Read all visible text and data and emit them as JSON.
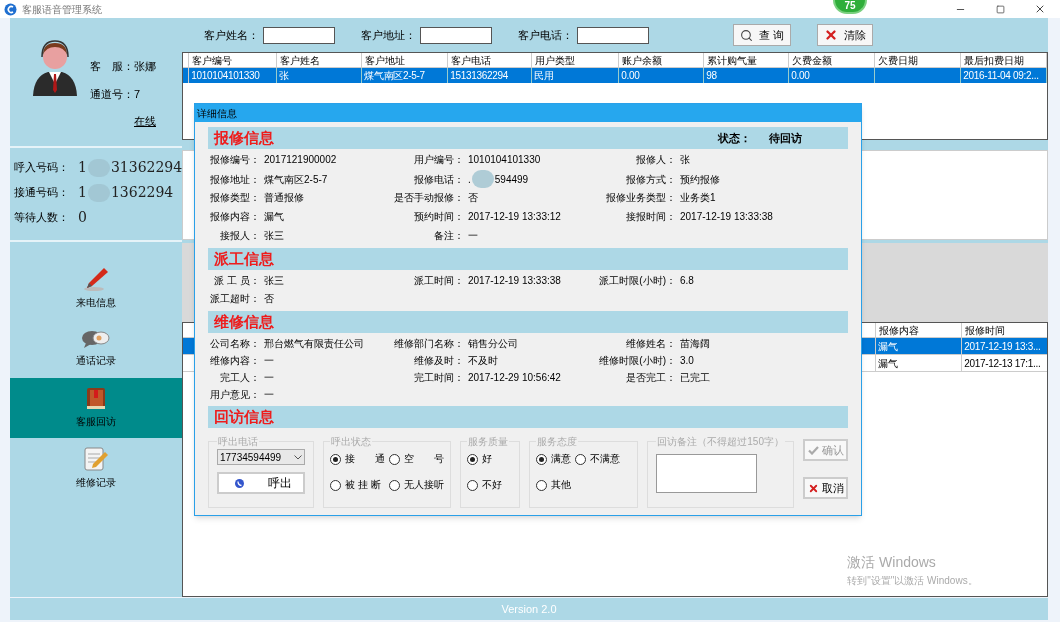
{
  "window": {
    "title": "客服语音管理系统",
    "badge": "75"
  },
  "agent": {
    "rows": [
      {
        "label": "客　服：",
        "value": "张娜"
      },
      {
        "label": "通道号：",
        "value": "7"
      }
    ],
    "status": "在线"
  },
  "call_info": [
    {
      "label": "呼入号码：",
      "value": "1",
      "value_end": "31362294"
    },
    {
      "label": "接通号码：",
      "value": "1",
      "value_end": "1362294"
    },
    {
      "label": "等待人数：",
      "value": "0"
    }
  ],
  "nav": [
    {
      "label": "来电信息",
      "kind": "pen",
      "selected": false
    },
    {
      "label": "通话记录",
      "kind": "chat",
      "selected": false
    },
    {
      "label": "客服回访",
      "kind": "book",
      "selected": true
    },
    {
      "label": "维修记录",
      "kind": "notepad",
      "selected": false
    }
  ],
  "search": {
    "fields": [
      {
        "label": "客户姓名："
      },
      {
        "label": "客户地址："
      },
      {
        "label": "客户电话："
      }
    ],
    "buttons": [
      {
        "label": "查 询",
        "kind": "search"
      },
      {
        "label": "清除",
        "kind": "clear"
      }
    ]
  },
  "customers": {
    "columns": [
      "客户编号",
      "客户姓名",
      "客户地址",
      "客户电话",
      "用户类型",
      "账户余额",
      "累计购气量",
      "欠费金额",
      "欠费日期",
      "最后扣费日期"
    ],
    "rows": [
      {
        "cells": [
          "1010104101330",
          "张",
          "煤气南区2-5-7",
          "15131362294",
          "民用",
          "0.00",
          "98",
          "0.00",
          "",
          "2016-11-04 09:2..."
        ],
        "selected": true
      }
    ]
  },
  "repairs": {
    "columns": [
      "报修内容",
      "报修时间"
    ],
    "rows": [
      {
        "cells": [
          "漏气",
          "2017-12-19 13:3..."
        ],
        "selected": true
      },
      {
        "cells": [
          "漏气",
          "2017-12-13 17:1..."
        ],
        "selected": false
      }
    ]
  },
  "dialog": {
    "title": "详细信息",
    "sections": [
      {
        "title": "报修信息",
        "status_label": "状态：",
        "status": "待回访",
        "rows": [
          [
            {
              "label": "报修编号：",
              "value": "2017121900002"
            },
            {
              "label": "用户编号：",
              "value": "1010104101330"
            },
            {
              "label": "报修人：",
              "value": "张"
            }
          ],
          [
            {
              "label": "报修地址：",
              "value": "煤气南区2-5-7"
            },
            {
              "label": "报修电话：",
              "value": ".",
              "value_end": "594499"
            },
            {
              "label": "报修方式：",
              "value": "预约报修"
            }
          ],
          [
            {
              "label": "报修类型：",
              "value": "普通报修"
            },
            {
              "label": "是否手动报修：",
              "value": "否"
            },
            {
              "label": "报修业务类型：",
              "value": "业务类1"
            }
          ],
          [
            {
              "label": "报修内容：",
              "value": "漏气"
            },
            {
              "label": "预约时间：",
              "value": "2017-12-19 13:33:12"
            },
            {
              "label": "接报时间：",
              "value": "2017-12-19 13:33:38"
            }
          ],
          [
            {
              "label": "接报人：",
              "value": "张三"
            },
            {
              "label": "备注：",
              "value": "一"
            }
          ]
        ]
      },
      {
        "title": "派工信息",
        "rows": [
          [
            {
              "label": "派 工 员：",
              "value": "张三"
            },
            {
              "label": "派工时间：",
              "value": "2017-12-19 13:33:38"
            },
            {
              "label": "派工时限(小时)：",
              "value": "6.8"
            }
          ],
          [
            {
              "label": "派工超时：",
              "value": "否"
            }
          ]
        ]
      },
      {
        "title": "维修信息",
        "rows": [
          [
            {
              "label": "公司名称：",
              "value": "邢台燃气有限责任公司"
            },
            {
              "label": "维修部门名称：",
              "value": "销售分公司"
            },
            {
              "label": "维修姓名：",
              "value": "苗海阔"
            }
          ],
          [
            {
              "label": "维修内容：",
              "value": "一"
            },
            {
              "label": "维修及时：",
              "value": "不及时"
            },
            {
              "label": "维修时限(小时)：",
              "value": "3.0"
            }
          ],
          [
            {
              "label": "完工人：",
              "value": "一"
            },
            {
              "label": "完工时间：",
              "value": "2017-12-29 10:56:42"
            },
            {
              "label": "是否完工：",
              "value": "已完工"
            }
          ],
          [
            {
              "label": "用户意见：",
              "value": "一"
            }
          ]
        ]
      },
      {
        "title": "回访信息"
      }
    ],
    "visit": {
      "phone": {
        "title": "呼出电话",
        "number": "17734594499",
        "call_button": "呼出"
      },
      "radio_groups": [
        {
          "title": "呼出状态",
          "options": [
            {
              "label": "接　　通",
              "selected": true
            },
            {
              "label": "空　　号",
              "selected": false
            },
            {
              "label": "被 挂 断",
              "selected": false
            },
            {
              "label": "无人接听",
              "selected": false
            }
          ]
        },
        {
          "title": "服务质量",
          "options": [
            {
              "label": "好",
              "selected": true
            },
            {
              "label": "不好",
              "selected": false
            }
          ]
        },
        {
          "title": "服务态度",
          "options": [
            {
              "label": "满意",
              "selected": true
            },
            {
              "label": "不满意",
              "selected": false
            },
            {
              "label": "其他",
              "selected": false
            }
          ]
        }
      ],
      "note": {
        "title": "回访备注（不得超过150字）"
      },
      "buttons": [
        {
          "label": "确认",
          "kind": "confirm",
          "disabled": true
        },
        {
          "label": "取消",
          "kind": "cancel",
          "disabled": false
        }
      ]
    }
  },
  "version": "Version 2.0",
  "os_notice": {
    "title": "激活 Windows",
    "text": "转到\"设置\"以激活 Windows。"
  }
}
